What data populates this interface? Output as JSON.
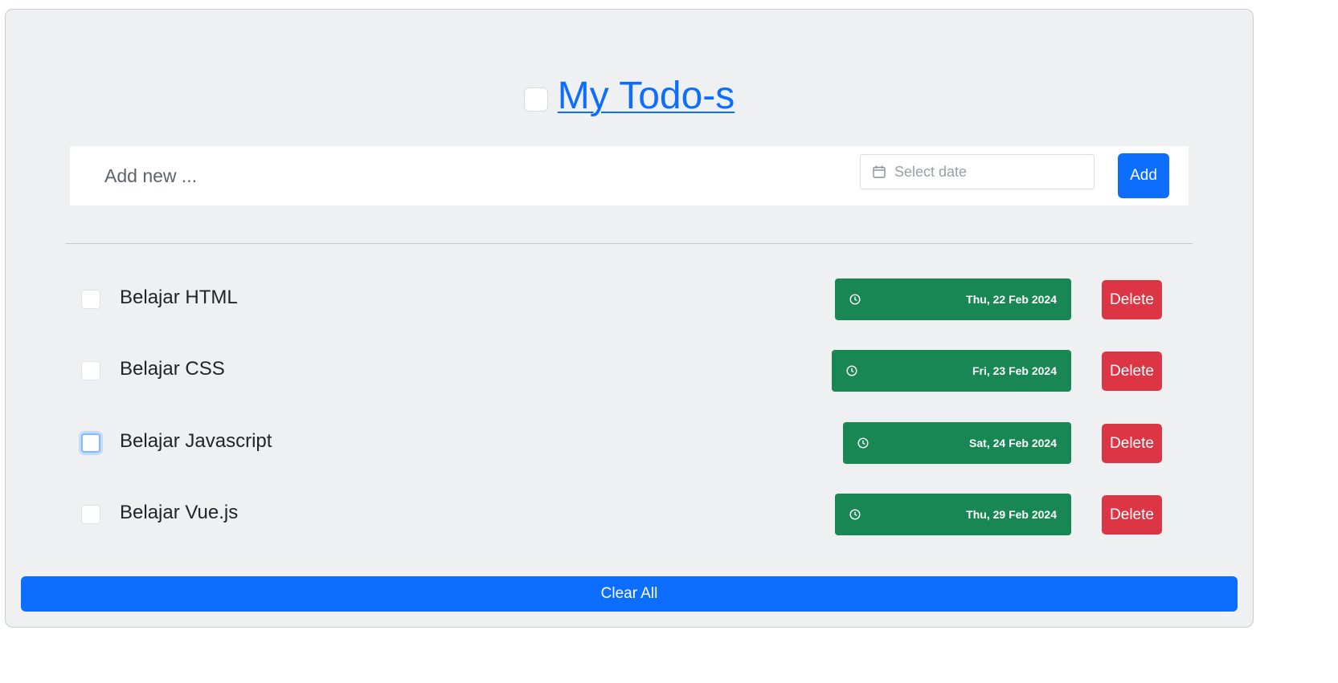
{
  "header": {
    "title": "My Todo-s"
  },
  "add_form": {
    "placeholder": "Add new ...",
    "date_placeholder": "Select date",
    "add_label": "Add"
  },
  "todos": [
    {
      "label": "Belajar HTML",
      "date": "Thu, 22 Feb 2024",
      "delete_label": "Delete",
      "checked": false
    },
    {
      "label": "Belajar CSS",
      "date": "Fri, 23 Feb 2024",
      "delete_label": "Delete",
      "checked": false
    },
    {
      "label": "Belajar Javascript",
      "date": "Sat, 24 Feb 2024",
      "delete_label": "Delete",
      "checked": false
    },
    {
      "label": "Belajar Vue.js",
      "date": "Thu, 29 Feb 2024",
      "delete_label": "Delete",
      "checked": false
    }
  ],
  "footer": {
    "clear_label": "Clear All"
  },
  "icons": {
    "date_field": "calendar-icon",
    "badge": "clock-icon"
  },
  "colors": {
    "primary": "#0d6efd",
    "success": "#198754",
    "danger": "#dc3545",
    "background": "#eff0f2"
  }
}
